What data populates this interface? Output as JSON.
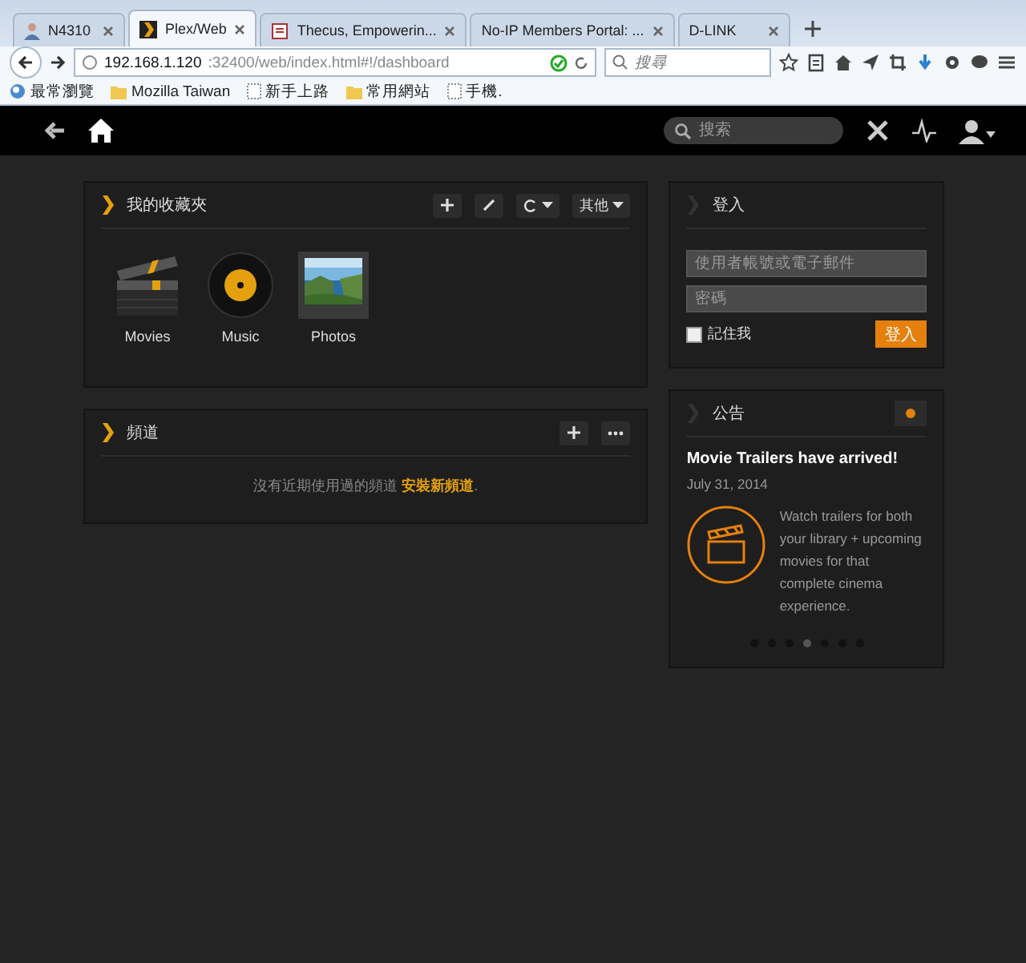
{
  "browser": {
    "tabs": [
      {
        "title": "N4310",
        "selected": false,
        "kind": "person"
      },
      {
        "title": "Plex/Web",
        "selected": true,
        "kind": "plex"
      },
      {
        "title": "Thecus, Empowerin...",
        "selected": false,
        "kind": "doc"
      },
      {
        "title": "No-IP Members Portal: ...",
        "selected": false,
        "kind": "plain"
      },
      {
        "title": "D-LINK",
        "selected": false,
        "kind": "plain"
      }
    ],
    "address": {
      "host": "192.168.1.120",
      "path": ":32400/web/index.html#!/dashboard"
    },
    "search": {
      "placeholder": "搜尋"
    },
    "bookmarks": [
      {
        "label": "最常瀏覽",
        "kind": "special"
      },
      {
        "label": "Mozilla Taiwan",
        "kind": "folder"
      },
      {
        "label": "新手上路",
        "kind": "page"
      },
      {
        "label": "常用網站",
        "kind": "folder"
      },
      {
        "label": "手機.",
        "kind": "page"
      }
    ]
  },
  "app_bar": {
    "search": {
      "placeholder": "搜索"
    }
  },
  "library": {
    "title": "我的收藏夾",
    "more_button": "其他",
    "items": [
      {
        "label": "Movies",
        "kind": "movies"
      },
      {
        "label": "Music",
        "kind": "music"
      },
      {
        "label": "Photos",
        "kind": "photos"
      }
    ]
  },
  "channels": {
    "title": "頻道",
    "message": "沒有近期使用過的頻道",
    "link": "安裝新頻道",
    "suffix": "."
  },
  "login": {
    "title": "登入",
    "username": {
      "placeholder": "使用者帳號或電子郵件"
    },
    "password": {
      "placeholder": "密碼"
    },
    "remember": {
      "label": "記住我",
      "checked": false
    },
    "button": "登入"
  },
  "announcements": {
    "title": "公告",
    "headline": "Movie Trailers have arrived!",
    "date": "July 31, 2014",
    "body": "Watch trailers for both your library + upcoming movies for that complete cinema experience.",
    "pages": [
      {
        "selected": false
      },
      {
        "selected": false
      },
      {
        "selected": false
      },
      {
        "selected": true
      },
      {
        "selected": false
      },
      {
        "selected": false
      },
      {
        "selected": false
      }
    ]
  }
}
